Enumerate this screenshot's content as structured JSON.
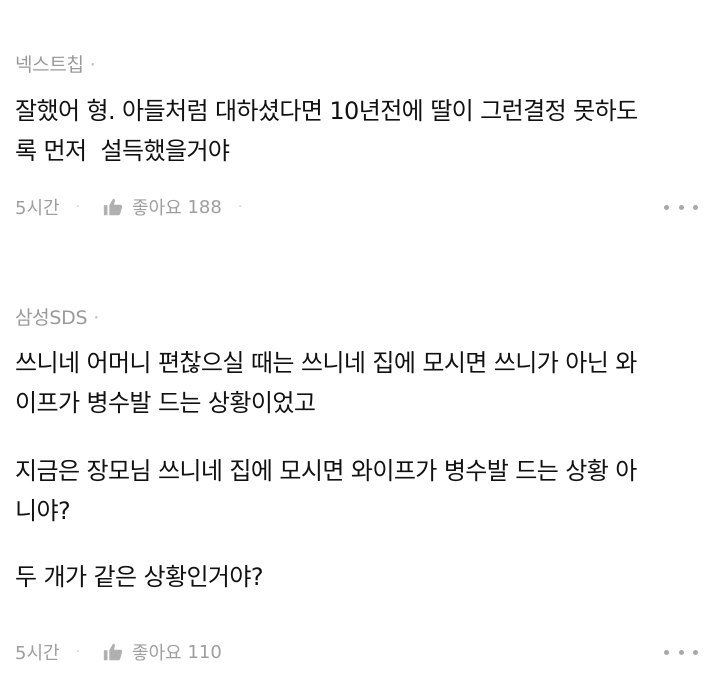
{
  "comments": [
    {
      "author": "넥스트칩",
      "paragraphs": [
        "잘했어 형. 아들처럼 대하셨다면 10년전에 딸이 그런결정 못하도\n록 먼저  설득했을거야"
      ],
      "time": "5시간",
      "like_label": "좋아요",
      "like_count": "188"
    },
    {
      "author": "삼성SDS",
      "paragraphs": [
        "쓰니네 어머니 편찮으실 때는 쓰니네 집에 모시면 쓰니가 아닌 와\n이프가 병수발 드는 상황이었고",
        "지금은 장모님 쓰니네 집에 모시면 와이프가 병수발 드는 상황 아\n니야?",
        "두 개가 같은 상황인거야?"
      ],
      "time": "5시간",
      "like_label": "좋아요",
      "like_count": "110"
    }
  ],
  "icons": {
    "like": "thumbs-up-icon",
    "more": "more-dots-icon"
  },
  "colors": {
    "text": "#111111",
    "meta": "#9e9e9e",
    "icon": "#b0b0b0"
  }
}
